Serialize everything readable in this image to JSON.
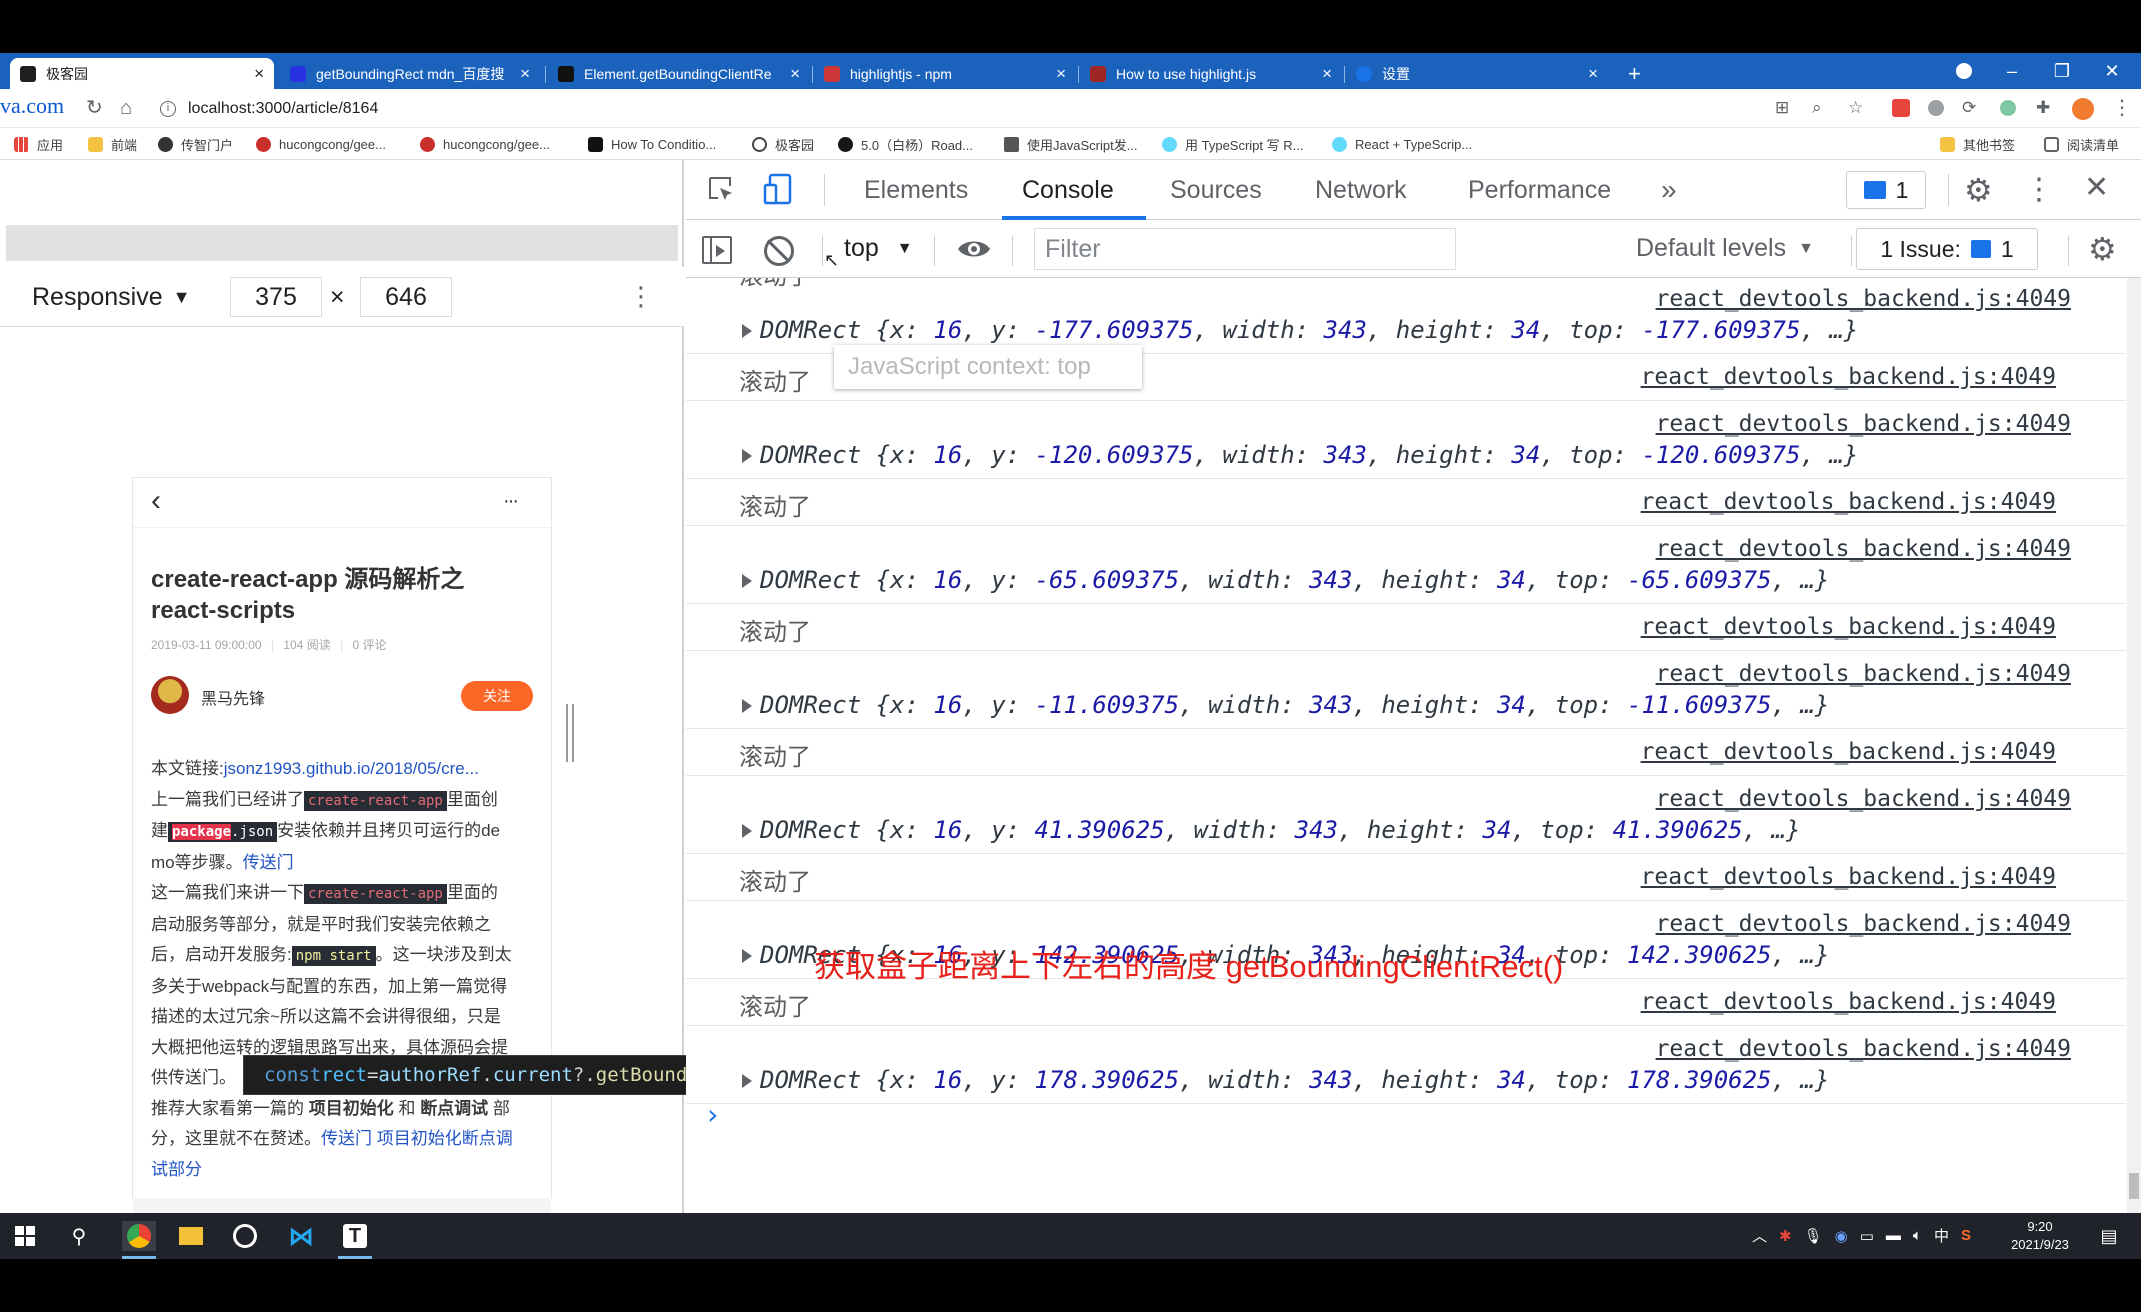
{
  "browser": {
    "tabs": [
      {
        "title": "极客园",
        "active": true,
        "color": "#1f1f1f"
      },
      {
        "title": "getBoundingRect mdn_百度搜",
        "active": false,
        "color": "#2932e1"
      },
      {
        "title": "Element.getBoundingClientRe",
        "active": false,
        "color": "#111111"
      },
      {
        "title": "highlightjs - npm",
        "active": false,
        "color": "#cb3837"
      },
      {
        "title": "How to use highlight.js",
        "active": false,
        "color": "#a02525"
      },
      {
        "title": "设置",
        "active": false,
        "color": "#1a73e8"
      }
    ],
    "url": "localhost:3000/article/8164",
    "partial_left_text": "va.com",
    "bookmarks": [
      {
        "label": "应用"
      },
      {
        "label": "前端"
      },
      {
        "label": "传智门户"
      },
      {
        "label": "hucongcong/gee..."
      },
      {
        "label": "hucongcong/gee..."
      },
      {
        "label": "How To Conditio..."
      },
      {
        "label": "极客园"
      },
      {
        "label": "5.0（白杨）Road..."
      },
      {
        "label": "使用JavaScript发..."
      },
      {
        "label": "用 TypeScript 写 R..."
      },
      {
        "label": "React + TypeScrip..."
      },
      {
        "label": "其他书签"
      },
      {
        "label": "阅读清单"
      }
    ]
  },
  "device": {
    "mode": "Responsive",
    "width": "375",
    "height": "646",
    "times": "×"
  },
  "article": {
    "back": "‹",
    "more": "···",
    "title": "create-react-app 源码解析之 react-scripts",
    "meta_date": "2019-03-11 09:00:00",
    "meta_reads": "104 阅读",
    "meta_comments": "0 评论",
    "author": "黑马先锋",
    "follow": "关注",
    "p1_prefix": "本文链接:",
    "p1_link": "jsonz1993.github.io/2018/05/cre...",
    "p2_a": "上一篇我们已经讲了",
    "code_cra": "create-react-app",
    "p2_b": "里面创",
    "p2_c": "建",
    "code_pkg_a": "package",
    "code_pkg_b": ".json",
    "p2_d": "安装依赖并且拷贝可运行的de",
    "p2_e": "mo等步骤。",
    "link_portal": "传送门",
    "p3_a": "这一篇我们来讲一下",
    "p3_b": "里面的",
    "p3_c": "启动服务等部分，就是平时我们安装完依赖之",
    "p3_d": "后，启动开发服务:",
    "code_npm": "npm start",
    "p3_e": "。这一块涉及到太",
    "p3_f": "多关于webpack与配置的东西，加上第一篇觉得",
    "p3_g": "描述的太过冗余~所以这篇不会讲得很细，只是",
    "p3_h": "大概把他运转的逻辑思路写出来，具体源码会提",
    "p3_i": "供传送门。",
    "p4_a": "推荐大家看第一篇的 ",
    "p4_b": "项目初始化",
    "p4_c": " 和 ",
    "p4_d": "断点调试",
    "p4_e": " 部",
    "p4_f": "分，这里就不在赘述。",
    "p4_link": "传送门 项目初始化断点调",
    "p4_link2": "试部分"
  },
  "code_overlay": {
    "kw": "const",
    "var": " rect",
    "eq": " = ",
    "obj": "authorRef",
    "dot": ".",
    "prop": "current",
    "opt": "?.",
    "fn": "getBoundingClientRect",
    "paren": "()",
    "bang": "!"
  },
  "devtools": {
    "tabs": [
      "Elements",
      "Console",
      "Sources",
      "Network",
      "Performance"
    ],
    "active_tab": "Console",
    "more_tabs": "»",
    "issues_badge": "1",
    "context": "top",
    "filter_placeholder": "Filter",
    "levels": "Default levels",
    "issues_label": "1 Issue:",
    "issues_count": "1",
    "tooltip": "JavaScript context: top",
    "source": "react_devtools_backend.js:4049",
    "scroll_msg": "滚动了",
    "prompt": "›",
    "annotation": "获取盒子距离上下左右的高度 getBoundingClientRect()",
    "annotation_color": "#e8201a",
    "rects": [
      {
        "x": "16",
        "y": "-177.609375",
        "width": "343",
        "height": "34",
        "top": "-177.609375"
      },
      {
        "x": "16",
        "y": "-120.609375",
        "width": "343",
        "height": "34",
        "top": "-120.609375"
      },
      {
        "x": "16",
        "y": "-65.609375",
        "width": "343",
        "height": "34",
        "top": "-65.609375"
      },
      {
        "x": "16",
        "y": "-11.609375",
        "width": "343",
        "height": "34",
        "top": "-11.609375"
      },
      {
        "x": "16",
        "y": "41.390625",
        "width": "343",
        "height": "34",
        "top": "41.390625"
      },
      {
        "x": "16",
        "y": "142.390625",
        "width": "343",
        "height": "34",
        "top": "142.390625"
      },
      {
        "x": "16",
        "y": "178.390625",
        "width": "343",
        "height": "34",
        "top": "178.390625"
      }
    ]
  },
  "taskbar": {
    "time": "9:20",
    "date": "2021/9/23",
    "ime": "中"
  }
}
